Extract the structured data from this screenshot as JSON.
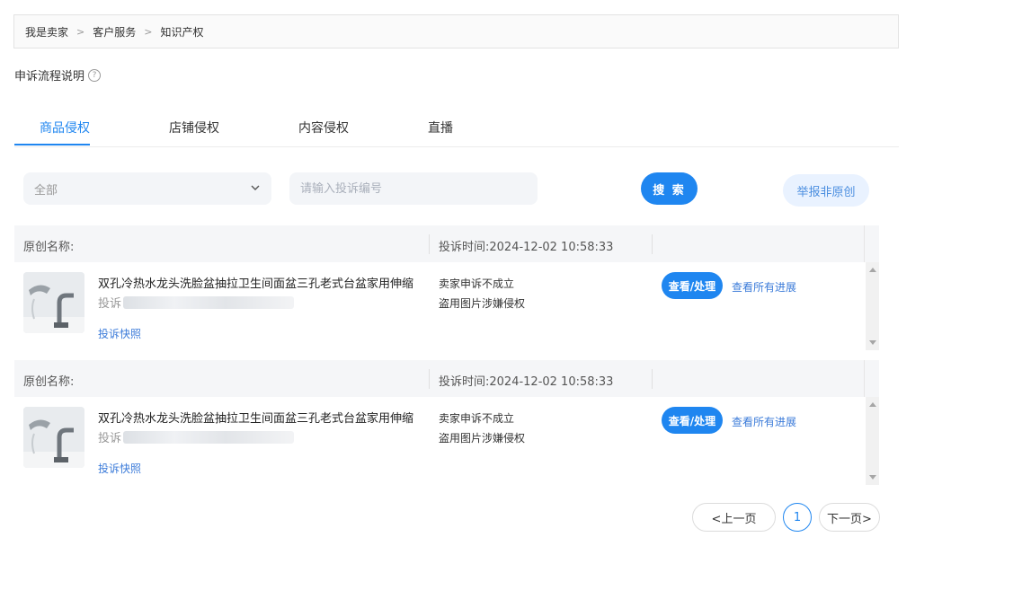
{
  "breadcrumb": {
    "items": [
      "我是卖家",
      "客户服务",
      "知识产权"
    ],
    "separator": ">"
  },
  "appeal_process": {
    "label": "申诉流程说明",
    "icon": "question-circle-icon"
  },
  "tabs": [
    {
      "label": "商品侵权",
      "active": true
    },
    {
      "label": "店铺侵权",
      "active": false
    },
    {
      "label": "内容侵权",
      "active": false
    },
    {
      "label": "直播",
      "active": false
    }
  ],
  "filters": {
    "category_select": {
      "value": "全部",
      "icon": "chevron-down-icon"
    },
    "search_input": {
      "placeholder": "请输入投诉编号",
      "value": ""
    },
    "search_button": "搜 索",
    "report_button": "举报非原创"
  },
  "complaints": [
    {
      "original_name_label": "原创名称:",
      "complaint_time": "投诉时间:2024-12-02 10:58:33",
      "product_title": "双孔冷热水龙头洗脸盆抽拉卫生间面盆三孔老式台盆家用伸缩",
      "complaint_no_label": "投诉",
      "snapshot_link": "投诉快照",
      "status": "卖家申诉不成立",
      "reason": "盗用图片涉嫌侵权",
      "view_button": "查看/处理",
      "progress_link": "查看所有进展"
    },
    {
      "original_name_label": "原创名称:",
      "complaint_time": "投诉时间:2024-12-02 10:58:33",
      "product_title": "双孔冷热水龙头洗脸盆抽拉卫生间面盆三孔老式台盆家用伸缩",
      "complaint_no_label": "投诉",
      "snapshot_link": "投诉快照",
      "status": "卖家申诉不成立",
      "reason": "盗用图片涉嫌侵权",
      "view_button": "查看/处理",
      "progress_link": "查看所有进展"
    }
  ],
  "pagination": {
    "prev": "<上一页",
    "current": "1",
    "next": "下一页>"
  },
  "colors": {
    "accent": "#1f86f0",
    "link": "#3b7bd9",
    "report_bg": "#e9f2ff"
  }
}
